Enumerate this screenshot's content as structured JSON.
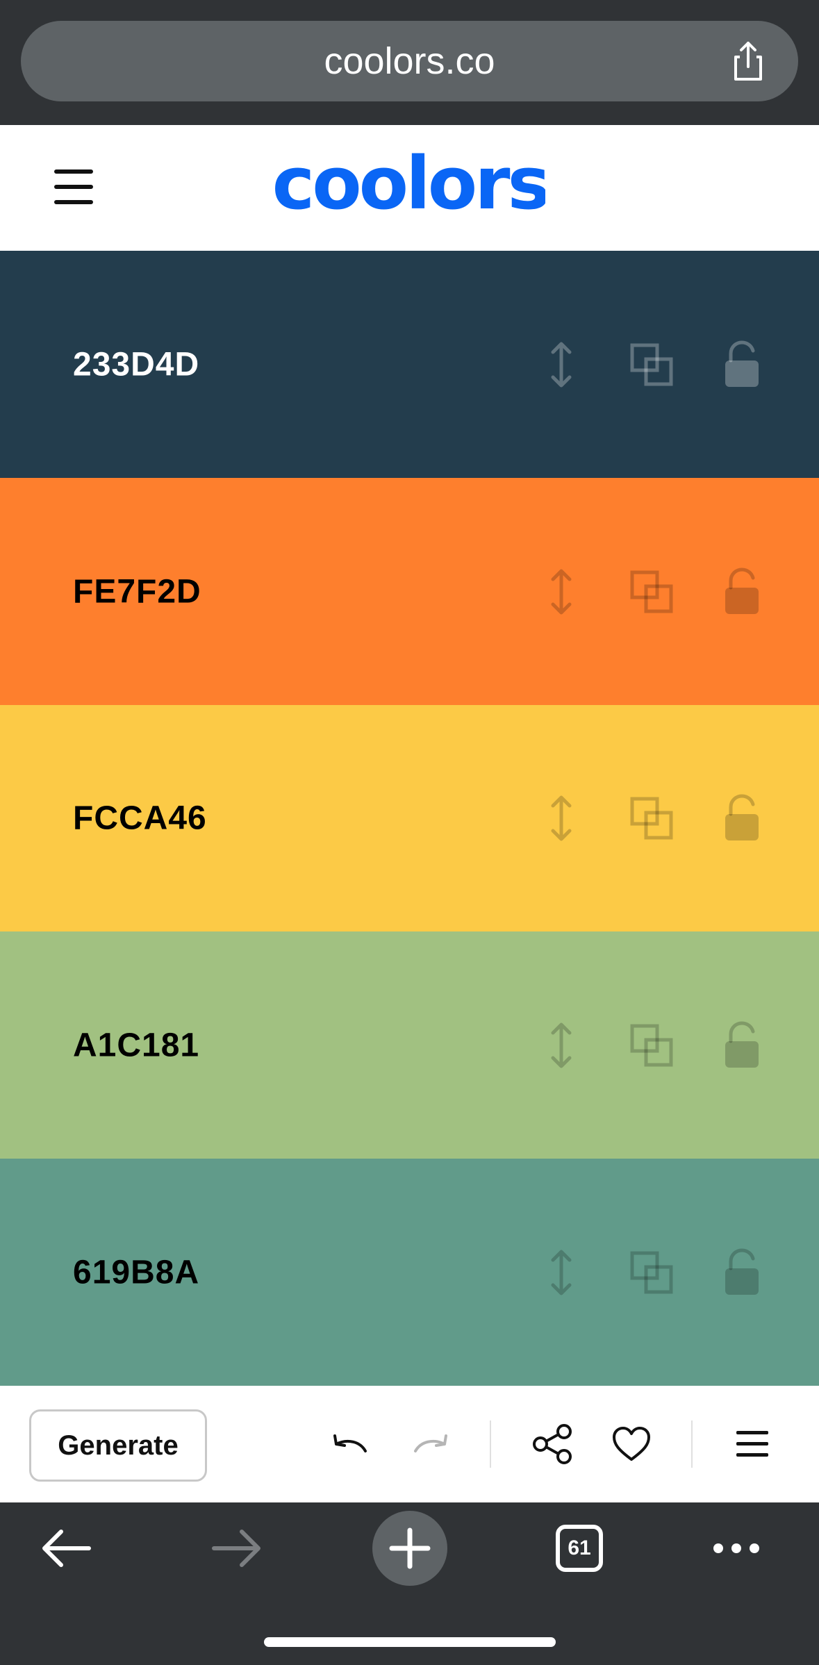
{
  "browser": {
    "url": "coolors.co",
    "tab_count": "61",
    "icons": [
      "share-icon",
      "back-arrow-icon",
      "forward-arrow-icon",
      "new-tab-plus-icon",
      "tabs-icon",
      "more-icon"
    ]
  },
  "header": {
    "logo_text": "coolors",
    "logo_color": "#0A66F5",
    "icons": [
      "hamburger-menu-icon"
    ]
  },
  "palette": [
    {
      "hex": "233D4D",
      "color": "#233D4D",
      "text_color": "#FFFFFF"
    },
    {
      "hex": "FE7F2D",
      "color": "#FE7F2D",
      "text_color": "#000000"
    },
    {
      "hex": "FCCA46",
      "color": "#FCCA46",
      "text_color": "#000000"
    },
    {
      "hex": "A1C181",
      "color": "#A1C181",
      "text_color": "#000000"
    },
    {
      "hex": "619B8A",
      "color": "#619B8A",
      "text_color": "#000000"
    }
  ],
  "swatch_icons": [
    "drag-move-icon",
    "copy-icon",
    "unlock-icon"
  ],
  "toolbar": {
    "generate_label": "Generate",
    "icons": [
      "undo-icon",
      "redo-icon",
      "share-icon",
      "heart-icon",
      "menu-icon"
    ]
  }
}
